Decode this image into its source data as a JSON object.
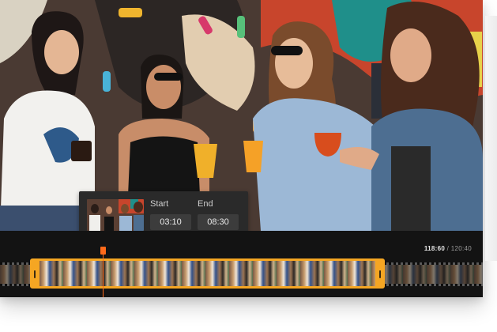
{
  "clip_editor": {
    "start_label": "Start",
    "start_value": "03:10",
    "end_label": "End",
    "end_value": "08:30"
  },
  "timeline": {
    "current_time": "118:60",
    "separator": " / ",
    "total_time": "120:40"
  },
  "colors": {
    "selection_accent": "#f5a623",
    "playhead": "#ff6a1a",
    "panel_bg": "#2a2a2a"
  }
}
